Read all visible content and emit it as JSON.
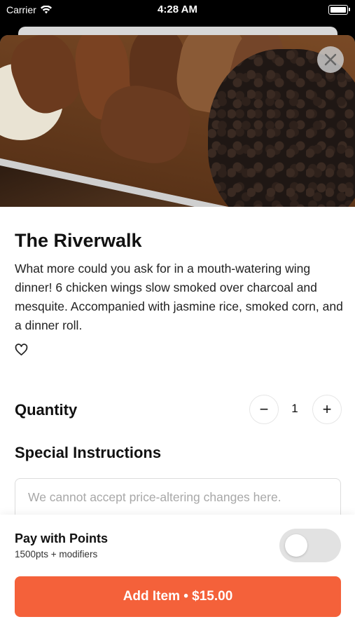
{
  "status_bar": {
    "carrier": "Carrier",
    "time": "4:28 AM",
    "icons": [
      "wifi-icon",
      "battery-icon"
    ]
  },
  "item": {
    "title": "The Riverwalk",
    "description": "What more could you ask for in a mouth-watering wing dinner! 6 chicken wings slow smoked over charcoal and mesquite. Accompanied with jasmine rice, smoked corn, and a dinner roll."
  },
  "quantity": {
    "label": "Quantity",
    "value": "1",
    "minus": "−",
    "plus": "+"
  },
  "special_instructions": {
    "label": "Special Instructions",
    "placeholder": "We cannot accept price-altering changes here."
  },
  "points": {
    "label": "Pay with Points",
    "sub": "1500pts + modifiers",
    "enabled": false
  },
  "add_button": {
    "label": "Add Item • $15.00",
    "color": "#f4613a"
  },
  "icons": {
    "close": "close-icon",
    "favorite": "heart-icon"
  }
}
